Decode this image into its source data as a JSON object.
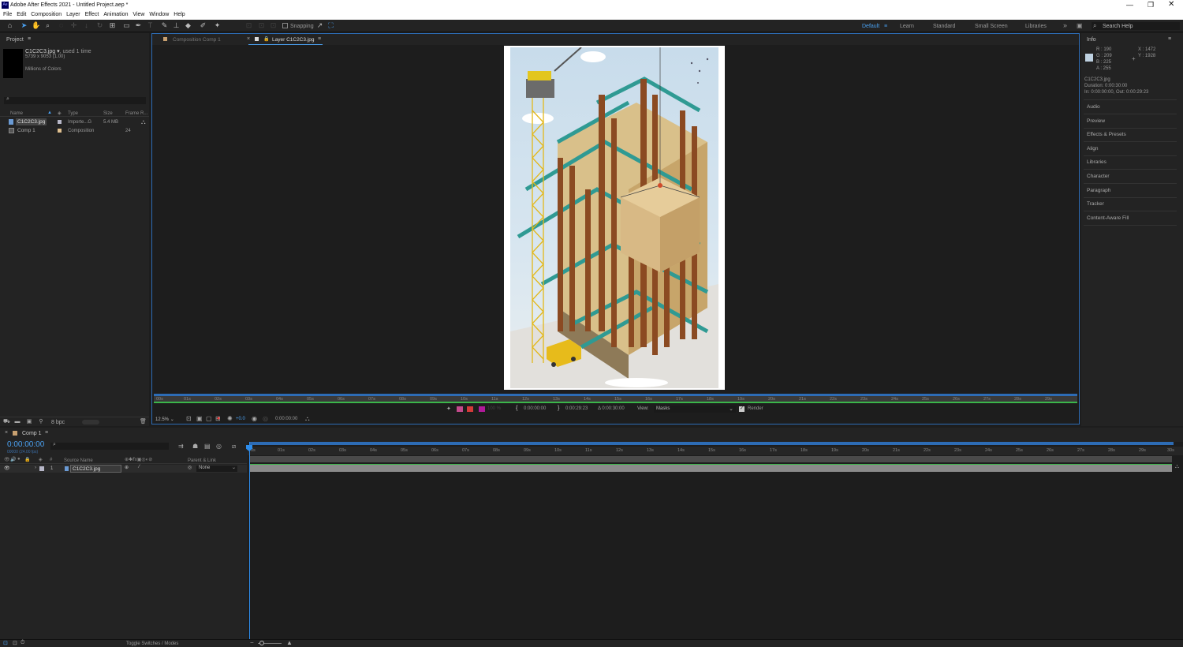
{
  "window": {
    "title": "Adobe After Effects 2021 - Untitled Project.aep *",
    "app_badge": "Ae"
  },
  "menu": [
    "File",
    "Edit",
    "Composition",
    "Layer",
    "Effect",
    "Animation",
    "View",
    "Window",
    "Help"
  ],
  "toolbar": {
    "snapping_label": "Snapping",
    "workspaces": [
      "Default",
      "Learn",
      "Standard",
      "Small Screen",
      "Libraries"
    ],
    "search_placeholder": "Search Help"
  },
  "project": {
    "tab_label": "Project",
    "selected_item": {
      "name": "C1C2C3.jpg",
      "used": ", used 1 time",
      "dims": "5739 x 9053 (1.00)",
      "colors": "Millions of Colors"
    },
    "columns": [
      "Name",
      "Type",
      "Size",
      "Frame R..."
    ],
    "items": [
      {
        "name": "C1C2C3.jpg",
        "type": "Importe...G",
        "size": "5.4 MB",
        "frame": ""
      },
      {
        "name": "Comp 1",
        "type": "Composition",
        "size": "",
        "frame": "24"
      }
    ],
    "bpc": "8 bpc"
  },
  "viewer": {
    "tabs": [
      "Composition  Comp 1",
      "Layer  C1C2C3.jpg"
    ],
    "ruler": [
      "00s",
      "01s",
      "02s",
      "03s",
      "04s",
      "05s",
      "06s",
      "07s",
      "08s",
      "09s",
      "10s",
      "11s",
      "12s",
      "13s",
      "14s",
      "15s",
      "16s",
      "17s",
      "18s",
      "19s",
      "20s",
      "21s",
      "22s",
      "23s",
      "24s",
      "25s",
      "26s",
      "27s",
      "28s",
      "29s"
    ],
    "in_time": "0:00:00:00",
    "out_time": "0:00:29:23",
    "duration": "Δ 0:00:30:00",
    "view_label": "View:",
    "view_value": "Masks",
    "render_label": "Render",
    "zoom": "12.5%",
    "exposure": "+0.0",
    "current_time": "0:00:00:00",
    "opacity": "100 %"
  },
  "info": {
    "tab_label": "Info",
    "r": "R : 190",
    "g": "G : 209",
    "b": "B : 225",
    "a": "A : 255",
    "x": "X : 1472",
    "y": "Y : 1928",
    "file": "C1C2C3.jpg",
    "duration": "Duration: 0:00:30:00",
    "inout": "In: 0:00:00:00, Out: 0:00:29:23",
    "sample_color": "#bed1e1",
    "panels": [
      "Audio",
      "Preview",
      "Effects & Presets",
      "Align",
      "Libraries",
      "Character",
      "Paragraph",
      "Tracker",
      "Content-Aware Fill"
    ]
  },
  "timeline": {
    "tab_label": "Comp 1",
    "timecode": "0:00:00:00",
    "fps": "00000 (24.00 fps)",
    "col_source": "Source Name",
    "col_parent": "Parent & Link",
    "layer": {
      "index": "1",
      "name": "C1C2C3.jpg",
      "parent": "None"
    },
    "ruler": [
      "0s",
      "01s",
      "02s",
      "03s",
      "04s",
      "05s",
      "06s",
      "07s",
      "08s",
      "09s",
      "10s",
      "11s",
      "12s",
      "13s",
      "14s",
      "15s",
      "16s",
      "17s",
      "18s",
      "19s",
      "20s",
      "21s",
      "22s",
      "23s",
      "24s",
      "25s",
      "26s",
      "27s",
      "28s",
      "29s",
      "30s"
    ],
    "toggle_label": "Toggle Switches / Modes"
  },
  "colors": {
    "accent": "#2d8ceb",
    "layer_bar": "#8a8a8a",
    "green": "#3bb54a"
  }
}
